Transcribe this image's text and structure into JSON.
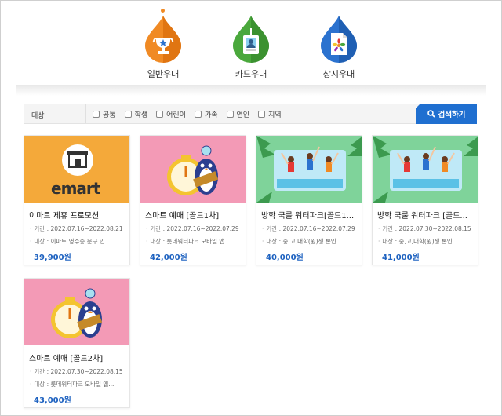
{
  "tabs": [
    {
      "label": "일반우대",
      "active": true,
      "color": "#f08a24",
      "icon": "trophy-icon"
    },
    {
      "label": "카드우대",
      "active": false,
      "color": "#4aa83c",
      "icon": "id-card-icon"
    },
    {
      "label": "상시우대",
      "active": false,
      "color": "#2b72cf",
      "icon": "document-icon"
    }
  ],
  "filter": {
    "title": "대상",
    "options": [
      "공통",
      "학생",
      "어린이",
      "가족",
      "연인",
      "지역"
    ],
    "search_label": "검색하기"
  },
  "labels": {
    "period": "기간",
    "target": "대상"
  },
  "products": [
    {
      "title": "이마트 제휴 프로모션",
      "period": "2022.07.16~2022.08.21",
      "target": "이마트 영수증 문구 인...",
      "price": "39,900원",
      "thumb": "emart",
      "brand_text": "emart"
    },
    {
      "title": "스마트 예매 [골드1차]",
      "period": "2022.07.16~2022.07.29",
      "target": "롯데워터파크 모바일 앱...",
      "price": "42,000원",
      "thumb": "penguin"
    },
    {
      "title": "방학 국룰 워터파크[골드1...",
      "period": "2022.07.16~2022.07.29",
      "target": "중,고,대학(원)생 본인",
      "price": "40,000원",
      "thumb": "waterpark"
    },
    {
      "title": "방학 국룰 워터파크 [골드...",
      "period": "2022.07.30~2022.08.15",
      "target": "중,고,대학(원)생 본인",
      "price": "41,000원",
      "thumb": "waterpark"
    },
    {
      "title": "스마트 예매 [골드2차]",
      "period": "2022.07.30~2022.08.15",
      "target": "롯데워터파크 모바일 앱...",
      "price": "43,000원",
      "thumb": "penguin"
    }
  ],
  "colors": {
    "search_button": "#1f6fd0",
    "price": "#1e62c0",
    "emart_bg": "#f4a93a",
    "penguin_bg": "#f39ab6",
    "waterpark_bg": "#7fd39a"
  }
}
